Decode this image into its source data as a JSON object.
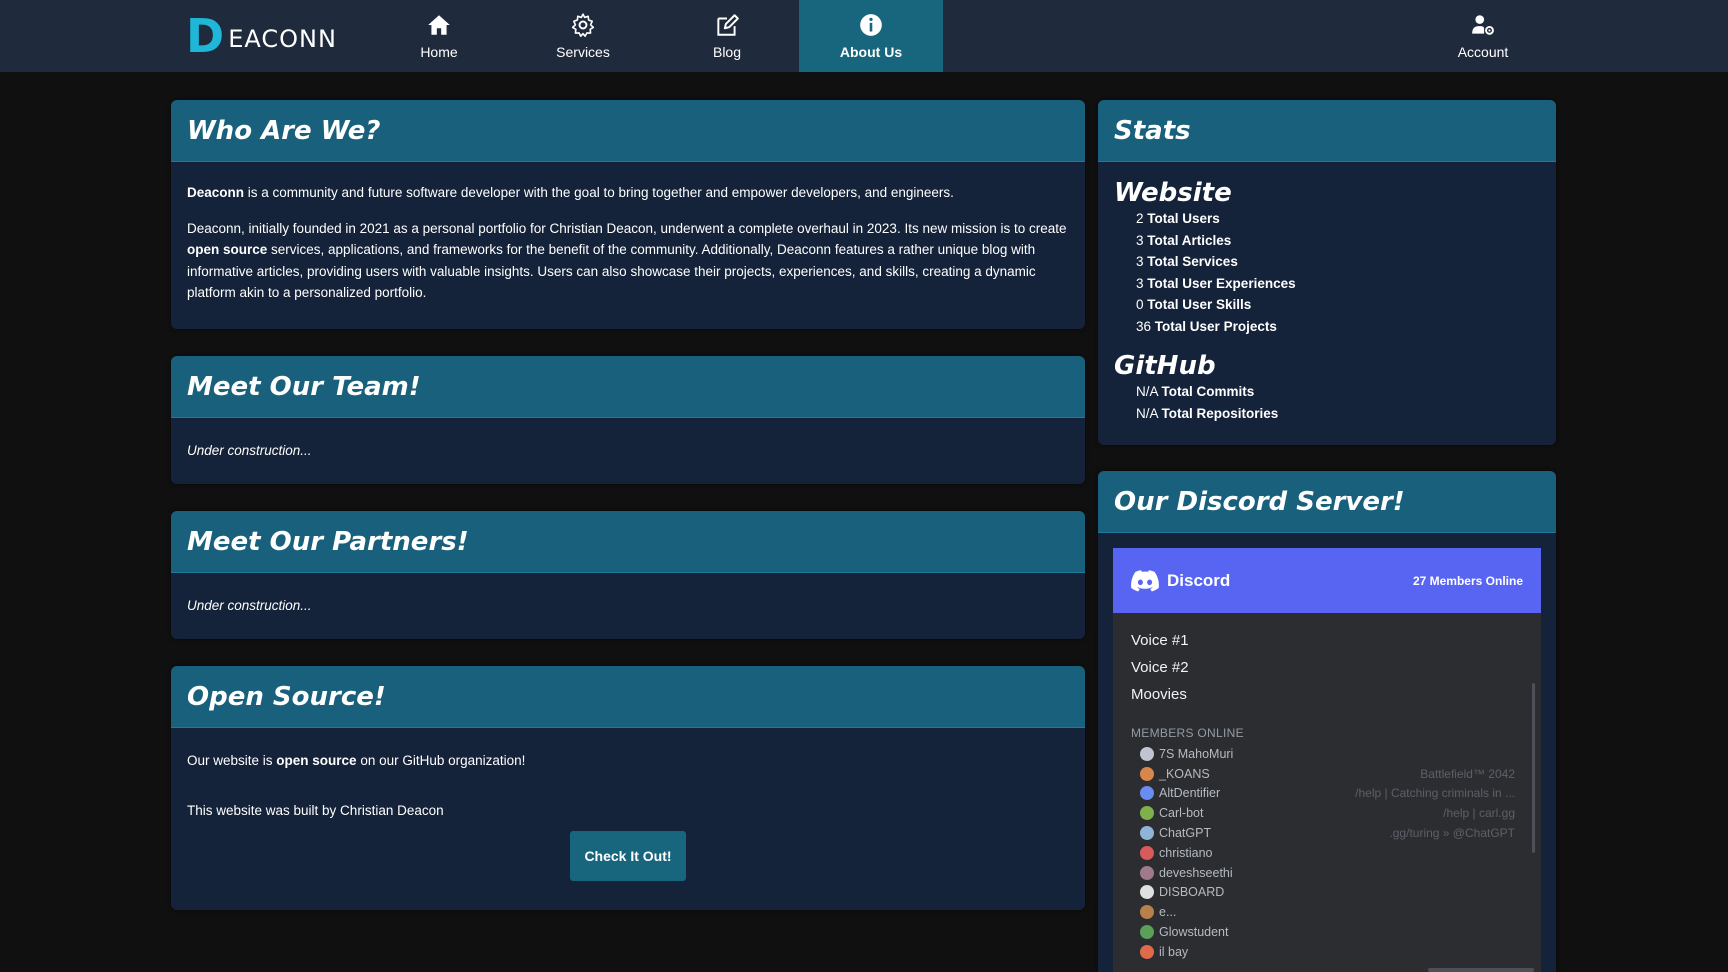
{
  "nav": {
    "logo_initial": "D",
    "logo_rest": "EACONN",
    "items": [
      {
        "label": "Home",
        "icon": "home-icon"
      },
      {
        "label": "Services",
        "icon": "gear-icon"
      },
      {
        "label": "Blog",
        "icon": "edit-icon"
      },
      {
        "label": "About Us",
        "icon": "info-icon"
      },
      {
        "label": "Account",
        "icon": "user-gear-icon"
      }
    ]
  },
  "who": {
    "title": "Who Are We?",
    "p1_bold": "Deaconn",
    "p1_rest": " is a community and future software developer with the goal to bring together and empower developers, and engineers.",
    "p2_a": "Deaconn, initially founded in 2021 as a personal portfolio for Christian Deacon, underwent a complete overhaul in 2023. Its new mission is to create ",
    "p2_bold": "open source",
    "p2_b": " services, applications, and frameworks for the benefit of the community. Additionally, Deaconn features a rather unique blog with informative articles, providing users with valuable insights. Users can also showcase their projects, experiences, and skills, creating a dynamic platform akin to a personalized portfolio."
  },
  "team": {
    "title": "Meet Our Team!",
    "text": "Under construction..."
  },
  "partners": {
    "title": "Meet Our Partners!",
    "text": "Under construction..."
  },
  "open_source": {
    "title": "Open Source!",
    "p1_a": "Our website is ",
    "p1_bold": "open source",
    "p1_b": " on our GitHub organization!",
    "p2": "This website was built by Christian Deacon",
    "button": "Check It Out!"
  },
  "stats": {
    "title": "Stats",
    "website_title": "Website",
    "website": [
      {
        "value": "2",
        "label": "Total Users"
      },
      {
        "value": "3",
        "label": "Total Articles"
      },
      {
        "value": "3",
        "label": "Total Services"
      },
      {
        "value": "3",
        "label": "Total User Experiences"
      },
      {
        "value": "0",
        "label": "Total User Skills"
      },
      {
        "value": "36",
        "label": "Total User Projects"
      }
    ],
    "github_title": "GitHub",
    "github": [
      {
        "value": "N/A",
        "label": "Total Commits"
      },
      {
        "value": "N/A",
        "label": "Total Repositories"
      }
    ]
  },
  "discord": {
    "title": "Our Discord Server!",
    "brand": "Discord",
    "online_count": "27",
    "online_label": " Members Online",
    "channels": [
      "Voice #1",
      "Voice #2",
      "Moovies"
    ],
    "members_title": "MEMBERS ONLINE",
    "members": [
      {
        "name": "7S MahoMuri",
        "game": "",
        "color": "#c0c4d0"
      },
      {
        "name": "_KOANS",
        "game": "Battlefield™ 2042",
        "color": "#d8874a"
      },
      {
        "name": "AltDentifier",
        "game": "/help | Catching criminals in ...",
        "color": "#6a8cf0"
      },
      {
        "name": "Carl-bot",
        "game": "/help | carl.gg",
        "color": "#7fb04a"
      },
      {
        "name": "ChatGPT",
        "game": ".gg/turing » @ChatGPT",
        "color": "#8fb4d8"
      },
      {
        "name": "christiano",
        "game": "",
        "color": "#d85a5a"
      },
      {
        "name": "deveshseethi",
        "game": "",
        "color": "#a07a8a"
      },
      {
        "name": "DISBOARD",
        "game": "",
        "color": "#e0e0e0"
      },
      {
        "name": "e...",
        "game": "",
        "color": "#b8804a"
      },
      {
        "name": "Glowstudent",
        "game": "",
        "color": "#5aa05a"
      },
      {
        "name": "il bay",
        "game": "",
        "color": "#e06a4a"
      }
    ],
    "colors": {
      "header": "#5865f2",
      "body": "#2b2d31"
    }
  },
  "colors": {
    "nav": "#1f2a3d",
    "accent": "#17667e",
    "card": "#142339",
    "card_head": "#18607c",
    "page": "#101010"
  }
}
